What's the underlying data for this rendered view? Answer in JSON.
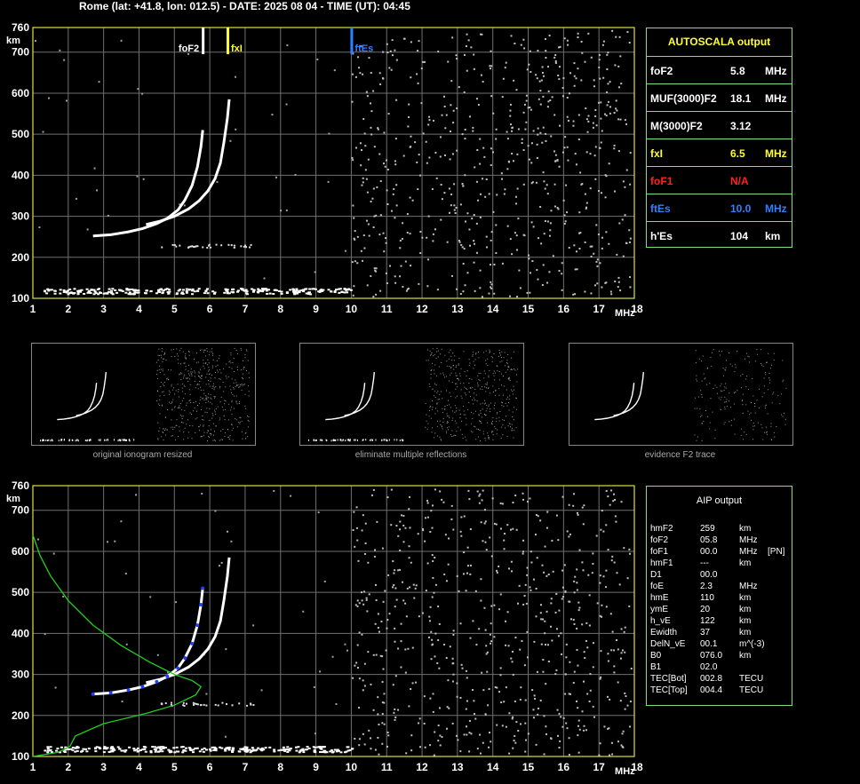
{
  "header": "Rome (lat: +41.8, lon: 012.5) - DATE: 2025 08 04 - TIME (UT): 04:45",
  "autoscala": {
    "title": "AUTOSCALA output",
    "rows": [
      {
        "label": "foF2",
        "value": "5.8",
        "unit": "MHz",
        "color": "#ffffff"
      },
      {
        "label": "MUF(3000)F2",
        "value": "18.1",
        "unit": "MHz",
        "color": "#ffffff"
      },
      {
        "label": "M(3000)F2",
        "value": "3.12",
        "unit": "",
        "color": "#ffffff"
      },
      {
        "label": "fxI",
        "value": "6.5",
        "unit": "MHz",
        "color": "#ffff30"
      },
      {
        "label": "foF1",
        "value": "N/A",
        "unit": "",
        "color": "#ff2020"
      },
      {
        "label": "ftEs",
        "value": "10.0",
        "unit": "MHz",
        "color": "#3080ff"
      },
      {
        "label": "h'Es",
        "value": "104",
        "unit": "km",
        "color": "#ffffff"
      }
    ]
  },
  "aip": {
    "title": "AIP output",
    "rows": [
      {
        "label": "hmF2",
        "value": "259",
        "unit": "km",
        "extra": ""
      },
      {
        "label": "foF2",
        "value": "05.8",
        "unit": "MHz",
        "extra": ""
      },
      {
        "label": "foF1",
        "value": "00.0",
        "unit": "MHz",
        "extra": "[PN]"
      },
      {
        "label": "hmF1",
        "value": "---",
        "unit": "km",
        "extra": ""
      },
      {
        "label": "D1",
        "value": "00.0",
        "unit": "",
        "extra": ""
      },
      {
        "label": "foE",
        "value": "2.3",
        "unit": "MHz",
        "extra": ""
      },
      {
        "label": "hmE",
        "value": "110",
        "unit": "km",
        "extra": ""
      },
      {
        "label": "ymE",
        "value": "20",
        "unit": "km",
        "extra": ""
      },
      {
        "label": "h_vE",
        "value": "122",
        "unit": "km",
        "extra": ""
      },
      {
        "label": "Ewidth",
        "value": "37",
        "unit": "km",
        "extra": ""
      },
      {
        "label": "DelN_vE",
        "value": "00.1",
        "unit": "m^(-3)",
        "extra": ""
      },
      {
        "label": "B0",
        "value": "076.0",
        "unit": "km",
        "extra": ""
      },
      {
        "label": "B1",
        "value": "02.0",
        "unit": "",
        "extra": ""
      },
      {
        "label": "TEC[Bot]",
        "value": "002.8",
        "unit": "TECU",
        "extra": ""
      },
      {
        "label": "TEC[Top]",
        "value": "004.4",
        "unit": "TECU",
        "extra": ""
      }
    ]
  },
  "captions": [
    "original ionogram resized",
    "eliminate multiple reflections",
    "evidence F2 trace"
  ],
  "markers": [
    {
      "label": "foF2",
      "freq": 5.8,
      "color": "#ffffff"
    },
    {
      "label": "fxI",
      "freq": 6.5,
      "color": "#ffff30"
    },
    {
      "label": "ftEs",
      "freq": 10.0,
      "color": "#3080ff"
    }
  ],
  "chart_data": [
    {
      "type": "scatter",
      "name": "autoscala-ionogram",
      "xlabel": "MHz",
      "ylabel": "km",
      "xlim": [
        1,
        18
      ],
      "ylim": [
        100,
        760
      ],
      "xticks": [
        1,
        2,
        3,
        4,
        5,
        6,
        7,
        8,
        9,
        10,
        11,
        12,
        13,
        14,
        15,
        16,
        17,
        18
      ],
      "yticks": [
        100,
        200,
        300,
        400,
        500,
        600,
        700,
        760
      ],
      "traces": {
        "o_trace": [
          [
            2.7,
            252
          ],
          [
            3.2,
            255
          ],
          [
            3.7,
            262
          ],
          [
            4.1,
            270
          ],
          [
            4.5,
            282
          ],
          [
            4.8,
            295
          ],
          [
            5.1,
            315
          ],
          [
            5.3,
            340
          ],
          [
            5.5,
            375
          ],
          [
            5.65,
            420
          ],
          [
            5.75,
            470
          ],
          [
            5.8,
            510
          ]
        ],
        "x_trace": [
          [
            4.2,
            280
          ],
          [
            4.6,
            288
          ],
          [
            5.0,
            300
          ],
          [
            5.4,
            318
          ],
          [
            5.7,
            338
          ],
          [
            5.95,
            362
          ],
          [
            6.15,
            392
          ],
          [
            6.3,
            430
          ],
          [
            6.4,
            480
          ],
          [
            6.5,
            540
          ],
          [
            6.55,
            585
          ]
        ],
        "es_layer": [
          [
            1.3,
            118
          ],
          [
            10.0,
            118
          ]
        ]
      }
    },
    {
      "type": "scatter",
      "name": "aip-ionogram",
      "xlabel": "MHz",
      "ylabel": "km",
      "xlim": [
        1,
        18
      ],
      "ylim": [
        100,
        760
      ],
      "xticks": [
        1,
        2,
        3,
        4,
        5,
        6,
        7,
        8,
        9,
        10,
        11,
        12,
        13,
        14,
        15,
        16,
        17,
        18
      ],
      "yticks": [
        100,
        200,
        300,
        400,
        500,
        600,
        700,
        760
      ],
      "profile": [
        [
          1.0,
          640
        ],
        [
          1.2,
          590
        ],
        [
          1.5,
          540
        ],
        [
          2.0,
          480
        ],
        [
          2.7,
          420
        ],
        [
          3.5,
          370
        ],
        [
          4.3,
          330
        ],
        [
          5.0,
          300
        ],
        [
          5.5,
          285
        ],
        [
          5.75,
          270
        ],
        [
          5.6,
          250
        ],
        [
          5.0,
          225
        ],
        [
          4.2,
          205
        ],
        [
          3.0,
          180
        ],
        [
          2.2,
          150
        ],
        [
          2.05,
          125
        ],
        [
          1.7,
          110
        ],
        [
          1.0,
          100
        ]
      ]
    }
  ]
}
